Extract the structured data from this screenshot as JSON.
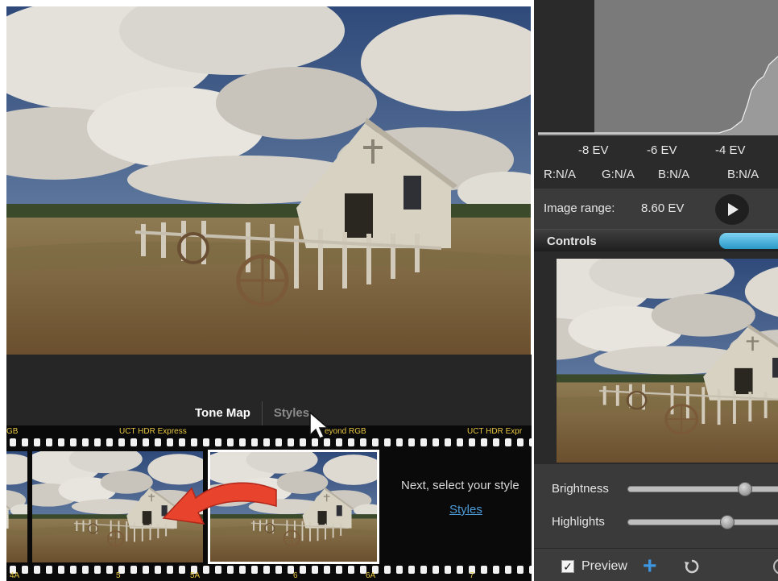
{
  "tabs": {
    "tone_map": "Tone Map",
    "styles": "Styles"
  },
  "filmstrip": {
    "top_labels": [
      "GB",
      "UCT HDR Express",
      "eyond RGB",
      "UCT HDR Expr"
    ],
    "bottom_labels": [
      "4A",
      "5",
      "5A",
      "6",
      "6A",
      "7"
    ],
    "next_text": "Next, select your style",
    "styles_link": "Styles"
  },
  "histogram": {
    "ev_ticks": [
      "-8 EV",
      "-6 EV",
      "-4 EV"
    ],
    "r": "R:N/A",
    "g": "G:N/A",
    "b": "B:N/A",
    "b2": "B:N/A",
    "image_range_label": "Image range:",
    "image_range_value": "8.60 EV"
  },
  "controls": {
    "title": "Controls",
    "brightness_label": "Brightness",
    "brightness_value": 0.73,
    "highlights_label": "Highlights",
    "highlights_value": 0.62
  },
  "bottom_bar": {
    "preview_label": "Preview",
    "preview_checked": true,
    "check_glyph": "✓",
    "add_glyph": "+"
  },
  "colors": {
    "accent": "#3e95e0",
    "toggle": "#4fb6e3",
    "film_text": "#e7c641",
    "arrow": "#e8432d"
  }
}
